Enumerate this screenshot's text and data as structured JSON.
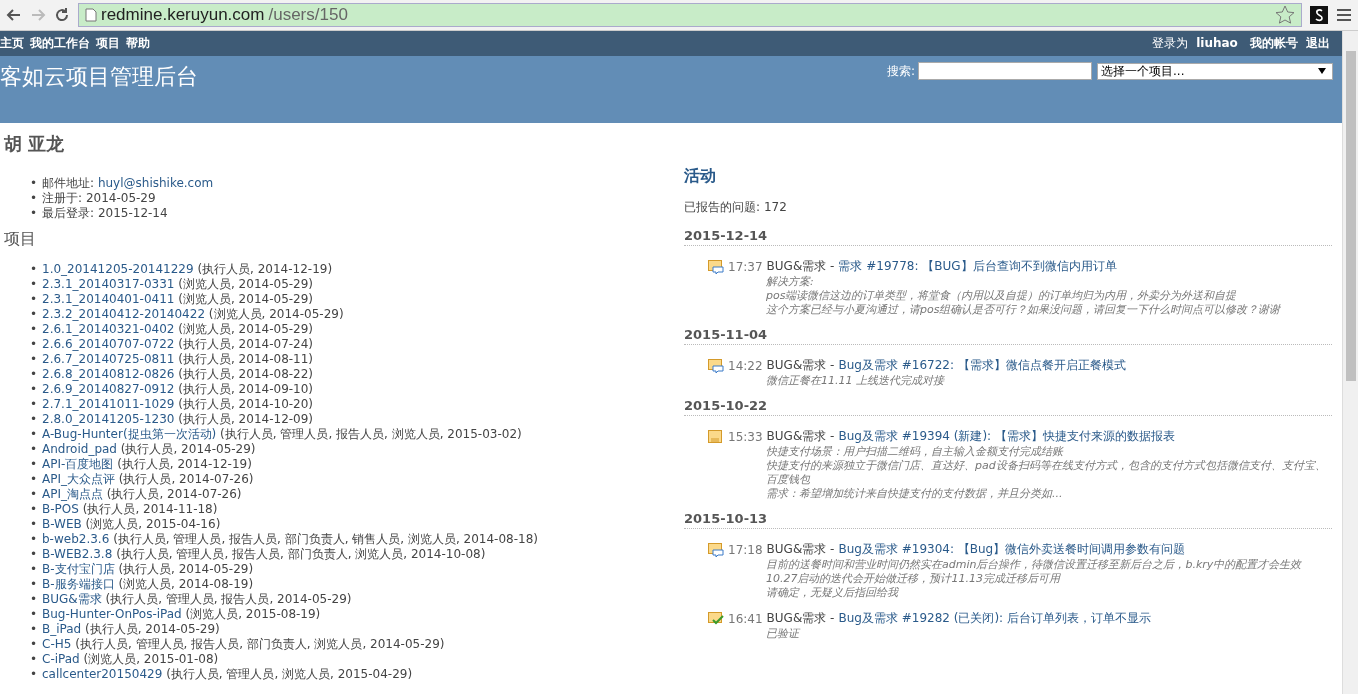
{
  "browser": {
    "url_host": "redmine.keruyun.com",
    "url_path": "/users/150"
  },
  "top_menu": {
    "left": [
      "主页",
      "我的工作台",
      "项目",
      "帮助"
    ],
    "logged_in_label": "登录为",
    "user": "liuhao",
    "right": [
      "我的帐号",
      "退出"
    ]
  },
  "header": {
    "title": "客如云项目管理后台",
    "search_label": "搜索:",
    "project_select": "选择一个项目..."
  },
  "user": {
    "name": "胡 亚龙",
    "bullet": "•",
    "details": [
      {
        "label": "邮件地址:",
        "value": "huyl@shishike.com",
        "kind": "link"
      },
      {
        "label": "注册于:",
        "value": "2014-05-29",
        "kind": "text"
      },
      {
        "label": "最后登录:",
        "value": "2015-12-14",
        "kind": "text"
      }
    ]
  },
  "projects": {
    "heading": "项目",
    "bullet": "•",
    "items": [
      {
        "name": "1.0_20141205-20141229",
        "roles": "(执行人员, 2014-12-19)"
      },
      {
        "name": "2.3.1_20140317-0331",
        "roles": "(浏览人员, 2014-05-29)"
      },
      {
        "name": "2.3.1_20140401-0411",
        "roles": "(浏览人员, 2014-05-29)"
      },
      {
        "name": "2.3.2_20140412-20140422",
        "roles": "(浏览人员, 2014-05-29)"
      },
      {
        "name": "2.6.1_20140321-0402",
        "roles": "(浏览人员, 2014-05-29)"
      },
      {
        "name": "2.6.6_20140707-0722",
        "roles": "(执行人员, 2014-07-24)"
      },
      {
        "name": "2.6.7_20140725-0811",
        "roles": "(执行人员, 2014-08-11)"
      },
      {
        "name": "2.6.8_20140812-0826",
        "roles": "(执行人员, 2014-08-22)"
      },
      {
        "name": "2.6.9_20140827-0912",
        "roles": "(执行人员, 2014-09-10)"
      },
      {
        "name": "2.7.1_20141011-1029",
        "roles": "(执行人员, 2014-10-20)"
      },
      {
        "name": "2.8.0_20141205-1230",
        "roles": "(执行人员, 2014-12-09)"
      },
      {
        "name": "A-Bug-Hunter(捉虫第一次活动)",
        "roles": "(执行人员, 管理人员, 报告人员, 浏览人员, 2015-03-02)"
      },
      {
        "name": "Android_pad",
        "roles": "(执行人员, 2014-05-29)"
      },
      {
        "name": "API-百度地图",
        "roles": "(执行人员, 2014-12-19)"
      },
      {
        "name": "API_大众点评",
        "roles": "(执行人员, 2014-07-26)"
      },
      {
        "name": "API_淘点点",
        "roles": "(执行人员, 2014-07-26)"
      },
      {
        "name": "B-POS",
        "roles": "(执行人员, 2014-11-18)"
      },
      {
        "name": "B-WEB",
        "roles": "(浏览人员, 2015-04-16)"
      },
      {
        "name": "b-web2.3.6",
        "roles": "(执行人员, 管理人员, 报告人员, 部门负责人, 销售人员, 浏览人员, 2014-08-18)"
      },
      {
        "name": "B-WEB2.3.8",
        "roles": "(执行人员, 管理人员, 报告人员, 部门负责人, 浏览人员, 2014-10-08)"
      },
      {
        "name": "B-支付宝门店",
        "roles": "(执行人员, 2014-05-29)"
      },
      {
        "name": "B-服务端接口",
        "roles": "(浏览人员, 2014-08-19)"
      },
      {
        "name": "BUG&需求",
        "roles": "(执行人员, 管理人员, 报告人员, 2014-05-29)"
      },
      {
        "name": "Bug-Hunter-OnPos-iPad",
        "roles": "(浏览人员, 2015-08-19)"
      },
      {
        "name": "B_iPad",
        "roles": "(执行人员, 2014-05-29)"
      },
      {
        "name": "C-H5",
        "roles": "(执行人员, 管理人员, 报告人员, 部门负责人, 浏览人员, 2014-05-29)"
      },
      {
        "name": "C-iPad",
        "roles": "(浏览人员, 2015-01-08)"
      },
      {
        "name": "callcenter20150429",
        "roles": "(执行人员, 管理人员, 浏览人员, 2015-04-29)"
      }
    ]
  },
  "activity": {
    "heading": "活动",
    "reported_label": "已报告的问题:",
    "reported_count": "172",
    "days": [
      {
        "date": "2015-12-14",
        "events": [
          {
            "kind": "note",
            "time": "17:37",
            "project": "BUG&需求 -",
            "link": "需求 #19778: 【BUG】后台查询不到微信内用订单",
            "lines": [
              "解决方案:",
              "pos端读微信这边的订单类型，将堂食（内用以及自提）的订单均归为内用，外卖分为外送和自提",
              "这个方案已经与小夏沟通过，请pos组确认是否可行？如果没问题，请回复一下什么时间点可以修改？谢谢"
            ]
          }
        ]
      },
      {
        "date": "2015-11-04",
        "events": [
          {
            "kind": "note",
            "time": "14:22",
            "project": "BUG&需求 -",
            "link": "Bug及需求 #16722: 【需求】微信点餐开启正餐模式",
            "lines": [
              "微信正餐在11.11 上线迭代完成对接"
            ]
          }
        ]
      },
      {
        "date": "2015-10-22",
        "events": [
          {
            "kind": "new",
            "time": "15:33",
            "project": "BUG&需求 -",
            "link": "Bug及需求 #19394 (新建): 【需求】快捷支付来源的数据报表",
            "lines": [
              "快捷支付场景：用户扫描二维码，自主输入金额支付完成结账",
              "快捷支付的来源独立于微信门店、直达好、pad设备扫码等在线支付方式，包含的支付方式包括微信支付、支付宝、百度钱包",
              "需求：希望增加统计来自快捷支付的支付数据，并且分类如..."
            ]
          }
        ]
      },
      {
        "date": "2015-10-13",
        "events": [
          {
            "kind": "note",
            "time": "17:18",
            "project": "BUG&需求 -",
            "link": "Bug及需求 #19304: 【Bug】微信外卖送餐时间调用参数有问题",
            "lines": [
              "目前的送餐时间和营业时间仍然实在admin后台操作，待微信设置迁移至新后台之后，b.kry中的配置才会生效",
              "10.27启动的迭代会开始做迁移，预计11.13完成迁移后可用",
              "请确定，无疑义后指回给我"
            ]
          },
          {
            "kind": "closed",
            "time": "16:41",
            "project": "BUG&需求 -",
            "link": "Bug及需求 #19282 (已关闭): 后台订单列表，订单不显示",
            "lines": [
              "已验证"
            ]
          }
        ]
      }
    ]
  }
}
